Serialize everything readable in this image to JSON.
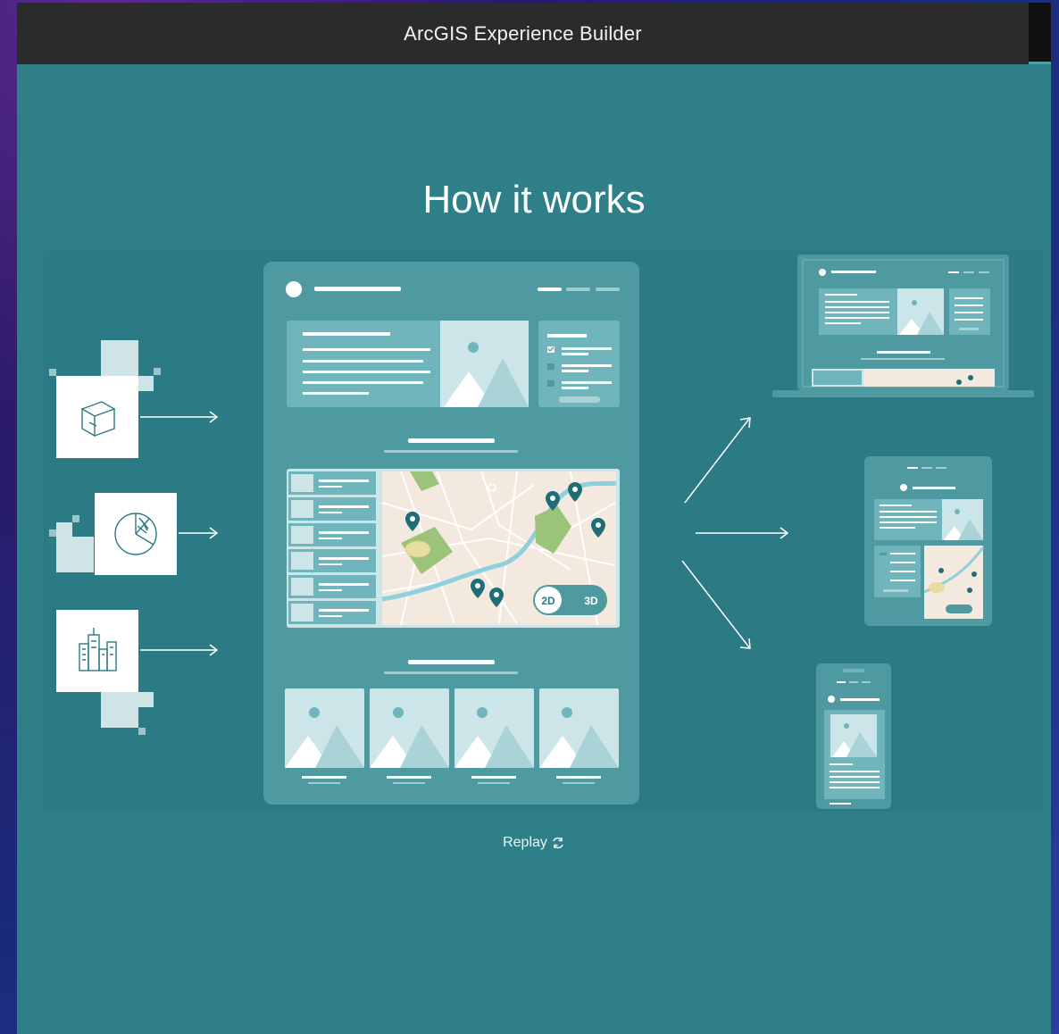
{
  "window": {
    "title": "ArcGIS Experience Builder"
  },
  "page": {
    "heading": "How it works"
  },
  "map": {
    "toggle_2d": "2D",
    "toggle_3d": "3D"
  },
  "replay": {
    "label": "Replay",
    "icon": "refresh-icon"
  },
  "colors": {
    "background": "#2f7f88",
    "titlebar": "#2b2b2b",
    "panel": "#4f9aa0",
    "card": "#6fb5bb",
    "map_land": "#f3e9df",
    "map_water": "#8fd0de",
    "map_park": "#9cc37a",
    "pin": "#1f6d76"
  }
}
